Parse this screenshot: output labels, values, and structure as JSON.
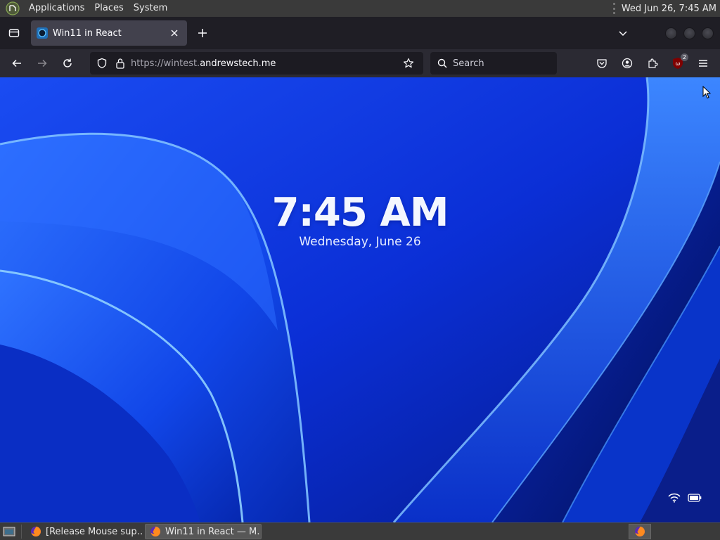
{
  "top_panel": {
    "menus": [
      "Applications",
      "Places",
      "System"
    ],
    "clock": "Wed Jun 26,  7:45 AM"
  },
  "browser": {
    "tab": {
      "title": "Win11 in React"
    },
    "url": {
      "scheme": "https://",
      "subdomain": "wintest.",
      "host": "andrewstech.me"
    },
    "search_placeholder": "Search",
    "ublock_badge": "2"
  },
  "page": {
    "time": "7:45 AM",
    "date": "Wednesday, June 26"
  },
  "taskbar": {
    "tasks": [
      {
        "label": "[Release Mouse sup…",
        "active": false
      },
      {
        "label": "Win11 in React — M…",
        "active": true
      }
    ]
  },
  "colors": {
    "wallpaper_base": "#0a2fd4",
    "toolbar": "#2b2a33",
    "tabbar": "#1f1e25",
    "panel": "#3a3a3a"
  },
  "icons": {
    "top_panel": "mint-logo-icon",
    "browser": [
      "list-all-tabs-icon",
      "favicon-icon",
      "close-icon",
      "plus-icon",
      "chevron-down-icon",
      "back-arrow-icon",
      "forward-arrow-icon",
      "reload-icon",
      "shield-icon",
      "lock-icon",
      "star-icon",
      "search-icon",
      "pocket-icon",
      "account-icon",
      "extensions-icon",
      "ublock-icon",
      "hamburger-menu-icon"
    ],
    "page": [
      "wifi-icon",
      "battery-icon"
    ]
  }
}
